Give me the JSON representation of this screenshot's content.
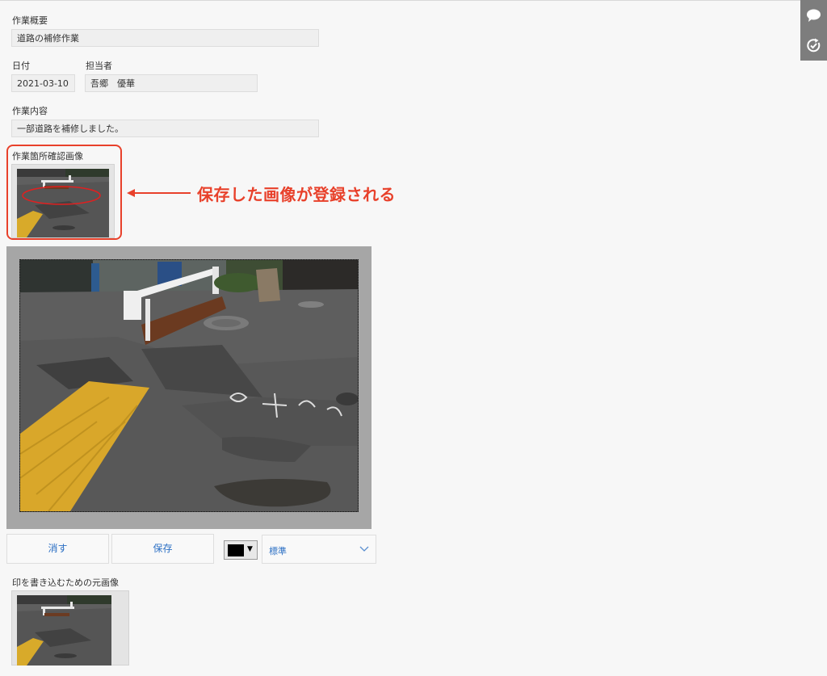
{
  "form": {
    "summary_label": "作業概要",
    "summary_value": "道路の補修作業",
    "date_label": "日付",
    "date_value": "2021-03-10",
    "person_label": "担当者",
    "person_value": "吾郷　優華",
    "content_label": "作業内容",
    "content_value": "一部道路を補修しました。",
    "confirm_image_label": "作業箇所確認画像",
    "source_image_label": "印を書き込むための元画像"
  },
  "annotation": {
    "text": "保存した画像が登録される",
    "color": "#e8412b"
  },
  "editor": {
    "erase_label": "消す",
    "save_label": "保存",
    "pen_color": "#000000",
    "line_width_value": "標準",
    "accent_color": "#2b6fc4"
  },
  "sidebar_icons": [
    "comment-icon",
    "refresh-check-icon"
  ]
}
